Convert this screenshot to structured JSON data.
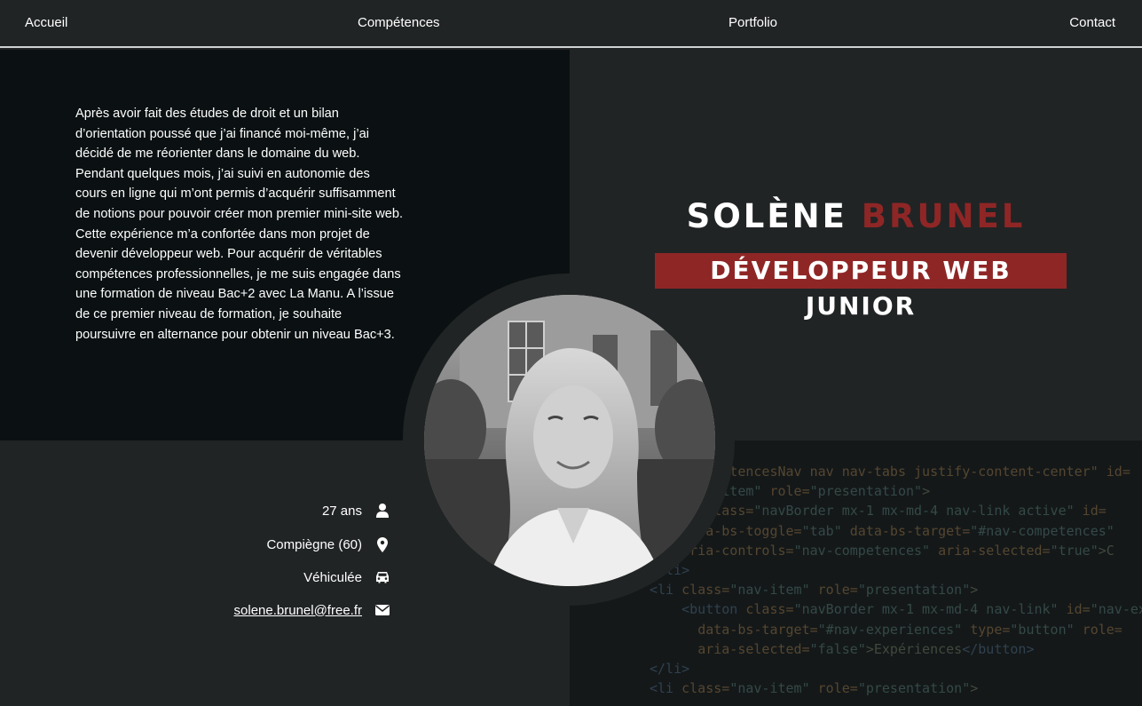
{
  "nav": {
    "items": [
      {
        "label": "Accueil"
      },
      {
        "label": "Compétences"
      },
      {
        "label": "Portfolio"
      },
      {
        "label": "Contact"
      }
    ]
  },
  "bio": {
    "text": "Après avoir fait des études de droit et un bilan d’orientation poussé que j’ai financé moi-même, j’ai décidé de me réorienter dans le domaine du web. Pendant quelques mois, j’ai suivi en autonomie des cours en ligne qui m’ont permis d’acquérir suffisamment de notions pour pouvoir créer mon premier mini-site web. Cette expérience m’a confortée dans mon projet de devenir développeur web. Pour acquérir de véritables compétences professionnelles, je me suis engagée dans une formation de niveau Bac+2 avec La Manu. A l’issue de ce premier niveau de formation, je souhaite poursuivre en alternance pour obtenir un niveau Bac+3."
  },
  "hero": {
    "first_name": "SOLÈNE",
    "last_name": "BRUNEL",
    "job_title": "DÉVELOPPEUR WEB JUNIOR"
  },
  "info": {
    "age": "27 ans",
    "location": "Compiègne (60)",
    "vehicle": "Véhiculée",
    "email": "solene.brunel@free.fr"
  },
  "icons": {
    "age": "user-icon",
    "location": "map-pin-icon",
    "vehicle": "car-icon",
    "email": "envelope-icon"
  },
  "colors": {
    "accent": "#8f2626",
    "background": "#212425",
    "panel_dark": "#0b1112"
  }
}
